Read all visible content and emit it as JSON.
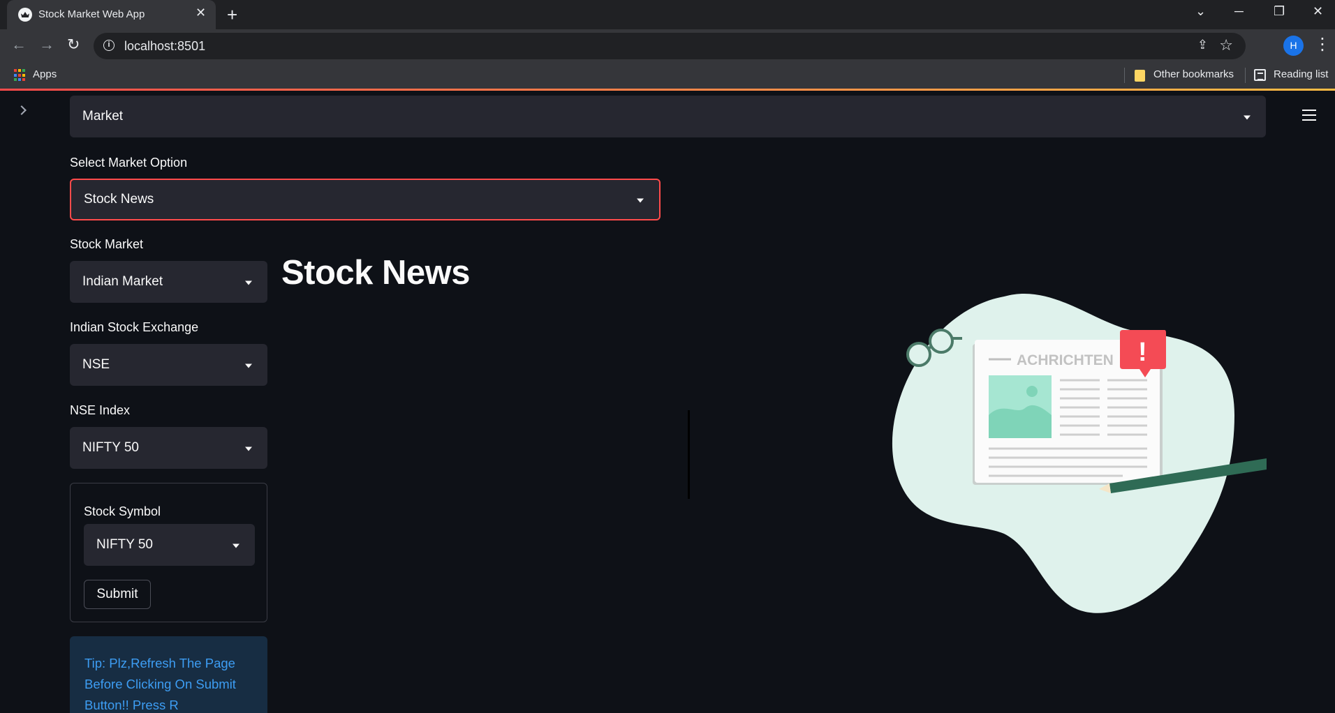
{
  "browser": {
    "tab_title": "Stock Market Web App",
    "url": "localhost:8501",
    "profile_initial": "H",
    "bookmarks": {
      "apps_label": "Apps",
      "other_label": "Other bookmarks",
      "reading_label": "Reading list"
    }
  },
  "app": {
    "main_select": {
      "value": "Market"
    },
    "market_option": {
      "label": "Select Market Option",
      "value": "Stock News"
    },
    "stock_market": {
      "label": "Stock Market",
      "value": "Indian Market"
    },
    "exchange": {
      "label": "Indian Stock Exchange",
      "value": "NSE"
    },
    "index": {
      "label": "NSE Index",
      "value": "NIFTY 50"
    },
    "form": {
      "symbol_label": "Stock Symbol",
      "symbol_value": "NIFTY 50",
      "submit_label": "Submit"
    },
    "tip": "Tip: Plz,Refresh The Page Before Clicking On Submit Button!! Press R",
    "heading": "Stock News",
    "illustration": {
      "headline": "ACHRICHTEN",
      "alert_glyph": "!"
    }
  },
  "colors": {
    "page_bg": "#0e1117",
    "select_bg": "#262730",
    "accent": "#ff4b4b",
    "tip_bg": "#172d43",
    "tip_text": "#3d9df3"
  }
}
